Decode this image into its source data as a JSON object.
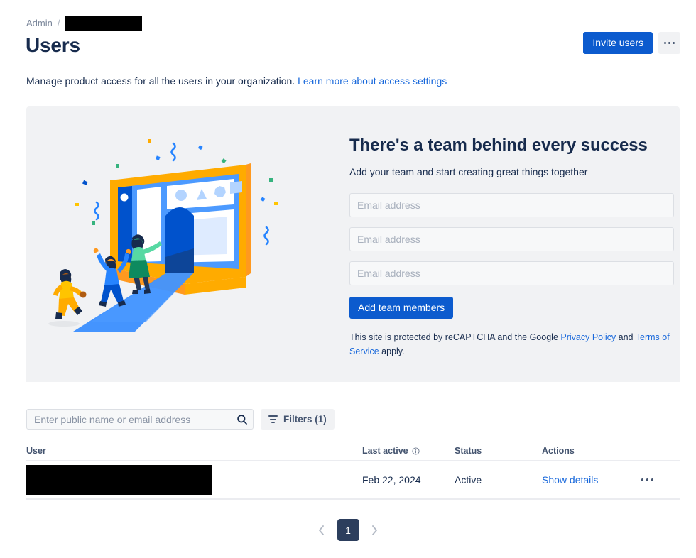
{
  "breadcrumb": {
    "root_label": "Admin",
    "separator": "/",
    "current_redacted": true
  },
  "header": {
    "title": "Users",
    "invite_label": "Invite users",
    "more_icon": "ellipsis-icon"
  },
  "description": {
    "text": "Manage product access for all the users in your organization.",
    "link_label": "Learn more about access settings"
  },
  "banner": {
    "heading": "There's a team behind every success",
    "subheading": "Add your team and start creating great things together",
    "email_placeholder": "Email address",
    "email_values": [
      "",
      "",
      ""
    ],
    "add_button_label": "Add team members",
    "recaptcha_prefix": "This site is protected by reCAPTCHA and the Google ",
    "privacy_label": "Privacy Policy",
    "recaptcha_mid": " and",
    "terms_label": "Terms of Service",
    "recaptcha_suffix": " apply.",
    "illustration_name": "team-behind-success-illustration"
  },
  "toolbar": {
    "search_placeholder": "Enter public name or email address",
    "search_value": "",
    "search_icon": "search-icon",
    "filters_label": "Filters (1)",
    "filters_icon": "funnel-icon"
  },
  "table": {
    "columns": [
      "User",
      "Last active",
      "Status",
      "Actions"
    ],
    "last_active_info_icon": "info-circle-icon",
    "rows": [
      {
        "user_redacted": true,
        "last_active": "Feb 22, 2024",
        "status": "Active",
        "action_label": "Show details",
        "row_more_icon": "ellipsis-icon"
      }
    ]
  },
  "pagination": {
    "prev_icon": "chevron-left-icon",
    "next_icon": "chevron-right-icon",
    "current_page": "1"
  },
  "colors": {
    "accent_blue": "#0C5BCE",
    "link_blue": "#1868DB",
    "text": "#172B4D",
    "muted": "#44546F",
    "banner_bg": "#F1F2F4",
    "pagination_active": "#2C3E5D"
  }
}
